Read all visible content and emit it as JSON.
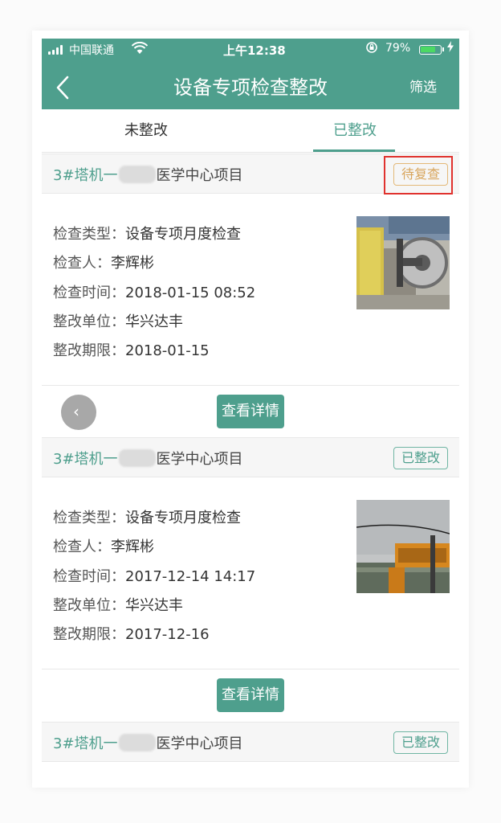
{
  "status_bar": {
    "carrier": "中国联通",
    "time": "上午12:38",
    "battery": "79%",
    "battery_level": 0.79
  },
  "header": {
    "title": "设备专项检查整改",
    "filter_label": "筛选",
    "back_icon": "chevron-left-icon"
  },
  "tabs": [
    {
      "label": "未整改",
      "active": false
    },
    {
      "label": "已整改",
      "active": true
    }
  ],
  "records": [
    {
      "title_prefix": "3#塔机一",
      "title_suffix": "医学中心项目",
      "status": "待复查",
      "type_label": "检查类型：",
      "type": "设备专项月度检查",
      "inspector_label": "检查人：",
      "inspector": "李辉彬",
      "time_label": "检查时间：",
      "time": "2018-01-15 08:52",
      "unit_label": "整改单位：",
      "unit": "华兴达丰",
      "deadline_label": "整改期限：",
      "deadline": "2018-01-15",
      "detail_label": "查看详情"
    },
    {
      "title_prefix": "3#塔机一",
      "title_suffix": "医学中心项目",
      "status": "已整改",
      "type_label": "检查类型：",
      "type": "设备专项月度检查",
      "inspector_label": "检查人：",
      "inspector": "李辉彬",
      "time_label": "检查时间：",
      "time": "2017-12-14 14:17",
      "unit_label": "整改单位：",
      "unit": "华兴达丰",
      "deadline_label": "整改期限：",
      "deadline": "2017-12-16",
      "detail_label": "查看详情"
    },
    {
      "title_prefix": "3#塔机一",
      "title_suffix": "医学中心项目",
      "status": "已整改"
    }
  ],
  "colors": {
    "primary": "#4e9f8d",
    "pending": "#d8a55c",
    "highlight": "#e0322e"
  }
}
